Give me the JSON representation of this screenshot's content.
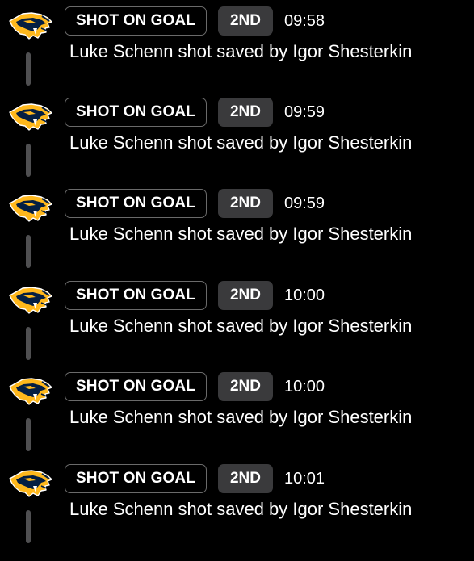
{
  "colors": {
    "background": "#000000",
    "text": "#ffffff",
    "type_badge_border": "#6a6a6a",
    "period_badge_bg": "#3a3a3c",
    "connector": "#4f4f51",
    "logo_gold": "#ffb81c",
    "logo_navy": "#041e42"
  },
  "events": [
    {
      "team_logo_icon": "nashville-predators-logo-icon",
      "type": "SHOT ON GOAL",
      "period": "2ND",
      "time": "09:58",
      "description": "Luke Schenn shot saved by Igor Shesterkin"
    },
    {
      "team_logo_icon": "nashville-predators-logo-icon",
      "type": "SHOT ON GOAL",
      "period": "2ND",
      "time": "09:59",
      "description": "Luke Schenn shot saved by Igor Shesterkin"
    },
    {
      "team_logo_icon": "nashville-predators-logo-icon",
      "type": "SHOT ON GOAL",
      "period": "2ND",
      "time": "09:59",
      "description": "Luke Schenn shot saved by Igor Shesterkin"
    },
    {
      "team_logo_icon": "nashville-predators-logo-icon",
      "type": "SHOT ON GOAL",
      "period": "2ND",
      "time": "10:00",
      "description": "Luke Schenn shot saved by Igor Shesterkin"
    },
    {
      "team_logo_icon": "nashville-predators-logo-icon",
      "type": "SHOT ON GOAL",
      "period": "2ND",
      "time": "10:00",
      "description": "Luke Schenn shot saved by Igor Shesterkin"
    },
    {
      "team_logo_icon": "nashville-predators-logo-icon",
      "type": "SHOT ON GOAL",
      "period": "2ND",
      "time": "10:01",
      "description": "Luke Schenn shot saved by Igor Shesterkin"
    }
  ]
}
